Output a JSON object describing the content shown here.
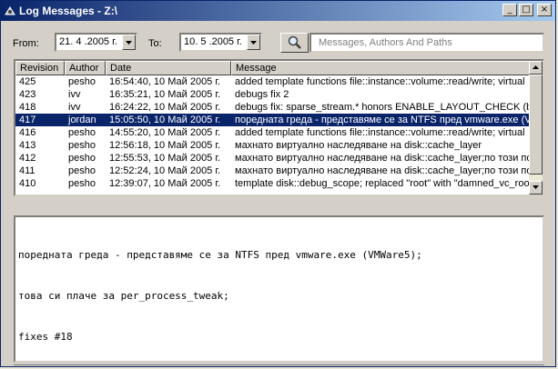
{
  "window": {
    "title": "Log Messages - Z:\\"
  },
  "title_buttons": {
    "minimize": "_",
    "maximize": "□",
    "close": "×"
  },
  "filters": {
    "from_label": "From:",
    "from_value": "21. 4 .2005 г.",
    "to_label": "To:",
    "to_value": "10. 5 .2005 г.",
    "search_placeholder": "Messages, Authors And Paths"
  },
  "table": {
    "columns": [
      "Revision",
      "Author",
      "Date",
      "Message"
    ],
    "rows": [
      {
        "revision": "425",
        "author": "pesho",
        "date": "16:54:40, 10 Май 2005 г.",
        "message": "added template functions file::instance::volume::read/write; virtual",
        "selected": false
      },
      {
        "revision": "423",
        "author": "ivv",
        "date": "16:35:21, 10 Май 2005 г.",
        "message": "debugs fix 2",
        "selected": false
      },
      {
        "revision": "418",
        "author": "ivv",
        "date": "16:24:22, 10 Май 2005 г.",
        "message": "debugs fix: sparse_stream.* honors ENABLE_LAYOUT_CHECK (build",
        "selected": false
      },
      {
        "revision": "417",
        "author": "jordan",
        "date": "15:05:50, 10 Май 2005 г.",
        "message": "поредната греда - представяме се за NTFS пред vmware.exe (V",
        "selected": true
      },
      {
        "revision": "416",
        "author": "pesho",
        "date": "14:55:20, 10 Май 2005 г.",
        "message": "added template functions file::instance::volume::read/write; virtual",
        "selected": false
      },
      {
        "revision": "413",
        "author": "pesho",
        "date": "12:56:18, 10 Май 2005 г.",
        "message": "махнато виртуално наследяване на disk::cache_layer",
        "selected": false
      },
      {
        "revision": "412",
        "author": "pesho",
        "date": "12:55:53, 10 Май 2005 г.",
        "message": "махнато виртуално наследяване на disk::cache_layer;по този по",
        "selected": false
      },
      {
        "revision": "411",
        "author": "pesho",
        "date": "12:52:24, 10 Май 2005 г.",
        "message": "махнато виртуално наследяване на disk::cache_layer;по този по",
        "selected": false
      },
      {
        "revision": "410",
        "author": "pesho",
        "date": "12:39:07, 10 Май 2005 г.",
        "message": "template disk::debug_scope; replaced \"root\" with \"damned_vc_root",
        "selected": false
      }
    ]
  },
  "detail": {
    "lines": [
      "поредната греда - представяме се за NTFS пред vmware.exe (VMWare5);",
      "това си плаче за per_process_tweak;",
      "fixes #18"
    ]
  }
}
